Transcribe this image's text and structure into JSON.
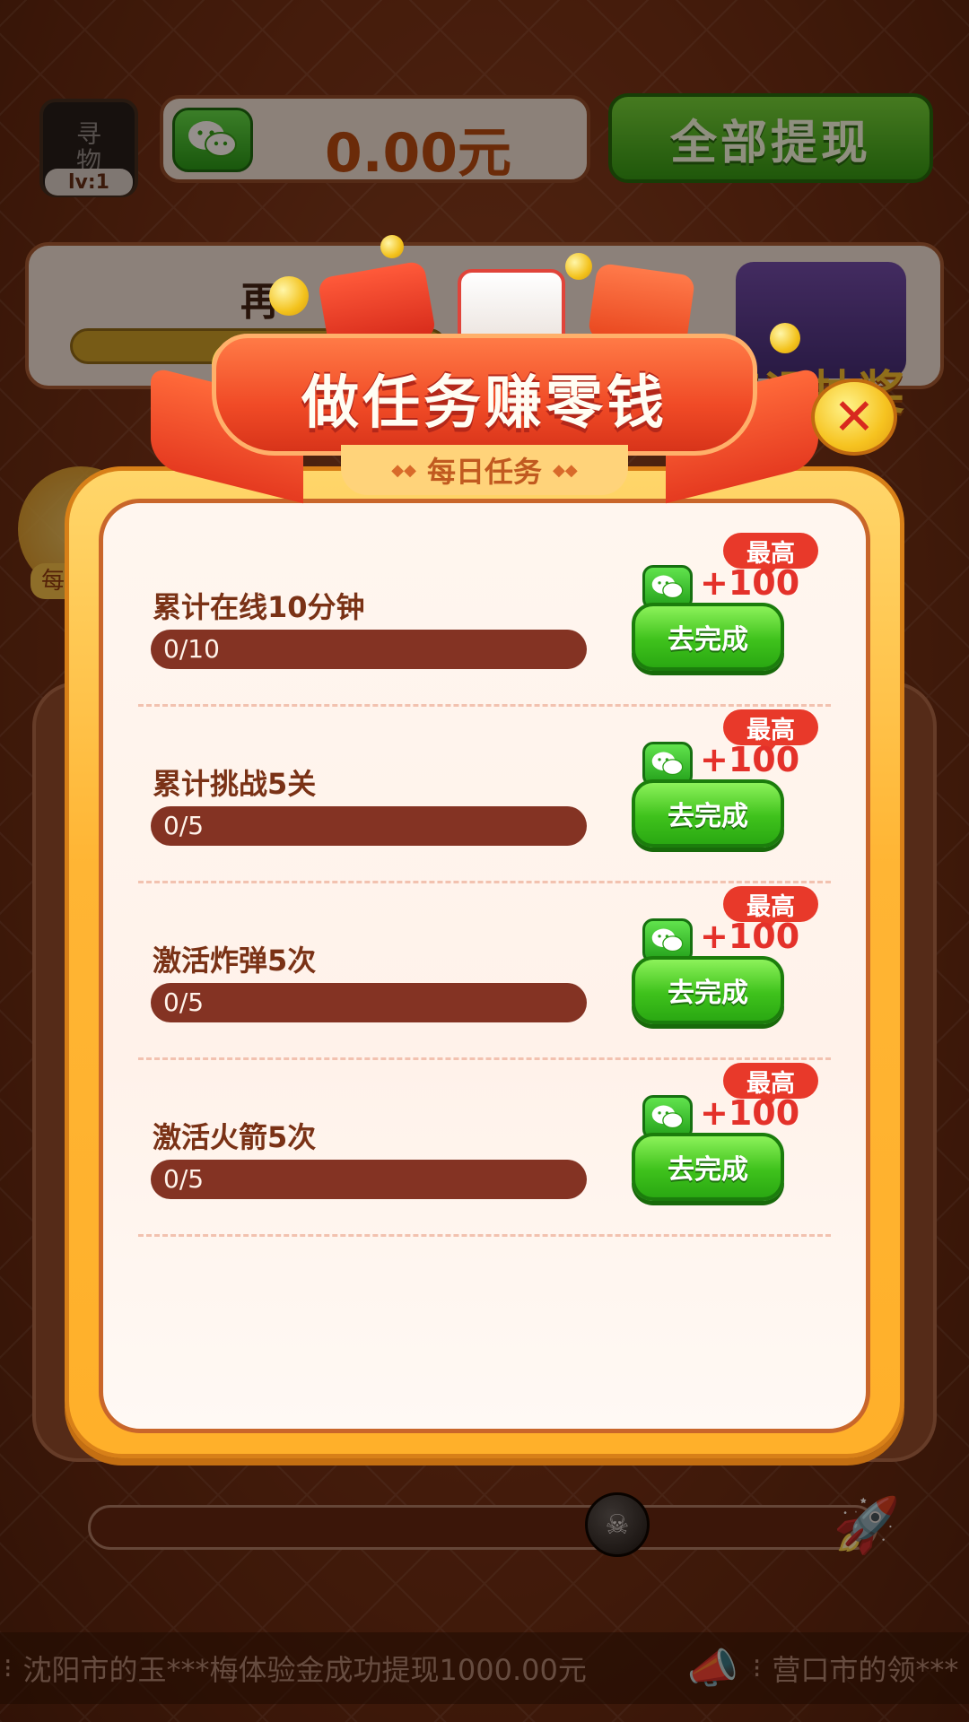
{
  "header": {
    "avatar_glyph": "寻\n物",
    "level": "lv:1",
    "balance": "0.00元",
    "withdraw_label": "全部提现"
  },
  "background": {
    "progress_hint": "再",
    "lottery_label": "幸运抽奖",
    "left_tag": "每"
  },
  "ticker": {
    "message_1": "沈阳市的玉***梅体验金成功提现1000.00元",
    "message_2": "营口市的领***"
  },
  "modal": {
    "title": "做任务赚零钱",
    "subtitle": "每日任务",
    "close_symbol": "✕",
    "tasks": [
      {
        "name": "累计在线10分钟",
        "progress_text": "0/10",
        "progress": 0,
        "badge": "最高",
        "reward": "+100",
        "button": "去完成"
      },
      {
        "name": "累计挑战5关",
        "progress_text": "0/5",
        "progress": 0,
        "badge": "最高",
        "reward": "+100",
        "button": "去完成"
      },
      {
        "name": "激活炸弹5次",
        "progress_text": "0/5",
        "progress": 0,
        "badge": "最高",
        "reward": "+100",
        "button": "去完成"
      },
      {
        "name": "激活火箭5次",
        "progress_text": "0/5",
        "progress": 0,
        "badge": "最高",
        "reward": "+100",
        "button": "去完成"
      }
    ]
  },
  "colors": {
    "accent_green": "#3fc21c",
    "accent_red": "#e8392a",
    "progress_track": "#843323",
    "frame_orange": "#ffb534"
  },
  "icons": {
    "wechat": "wechat-icon",
    "close": "close-icon",
    "bomb": "bomb-icon",
    "rocket": "rocket-icon",
    "horn": "horn-icon"
  }
}
